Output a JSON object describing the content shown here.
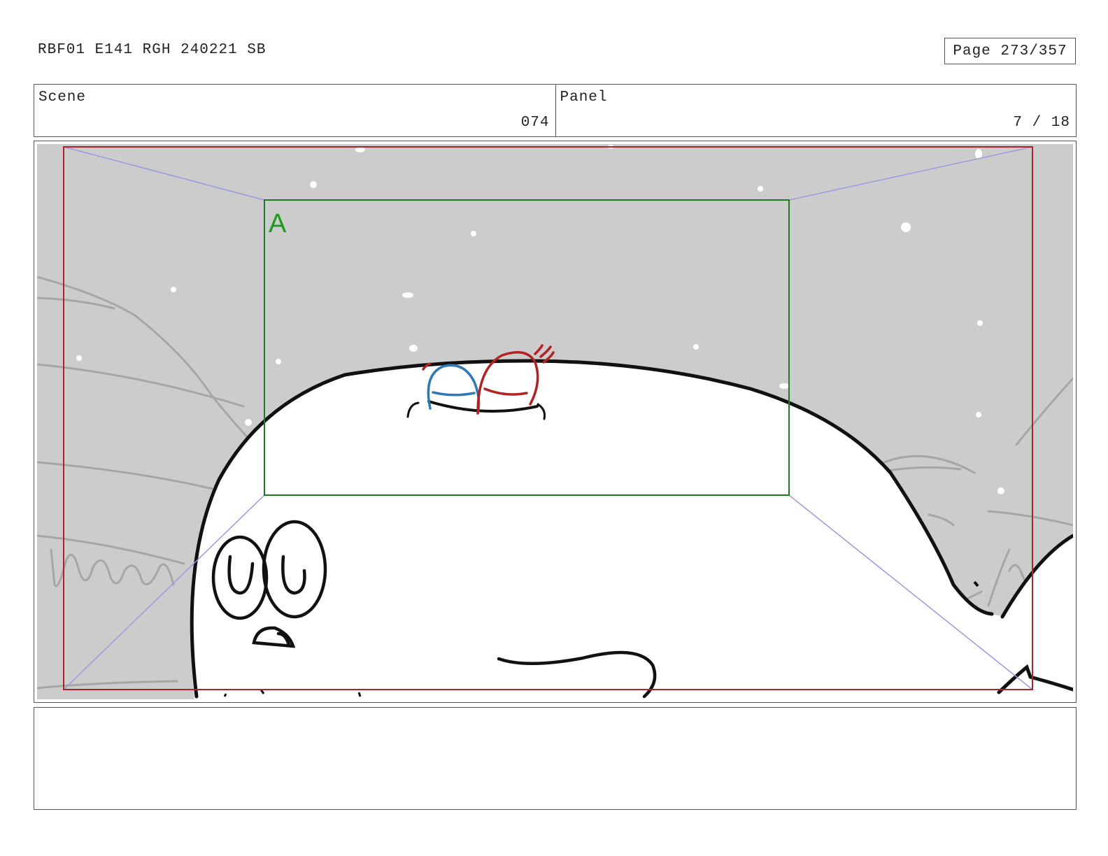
{
  "header": {
    "document_title": "RBF01 E141 RGH 240221 SB",
    "page_indicator": "Page 273/357"
  },
  "info": {
    "scene_label": "Scene",
    "scene_value": "074",
    "panel_label": "Panel",
    "panel_value": "7 / 18"
  },
  "panel": {
    "camera_frame_label": "A",
    "colors": {
      "sky": "#cccccc",
      "safe_frame": "#b0212b",
      "camera_frame": "#1f7a1f",
      "camera_label": "#1e9a1e",
      "camera_move_lines": "#9a9adf",
      "character_blue": "#2f79b4",
      "character_red": "#b22222"
    },
    "icons": [
      "eye-sketch",
      "mouth-sketch",
      "character-head-blue",
      "character-head-red"
    ]
  },
  "notes": {
    "text": ""
  }
}
